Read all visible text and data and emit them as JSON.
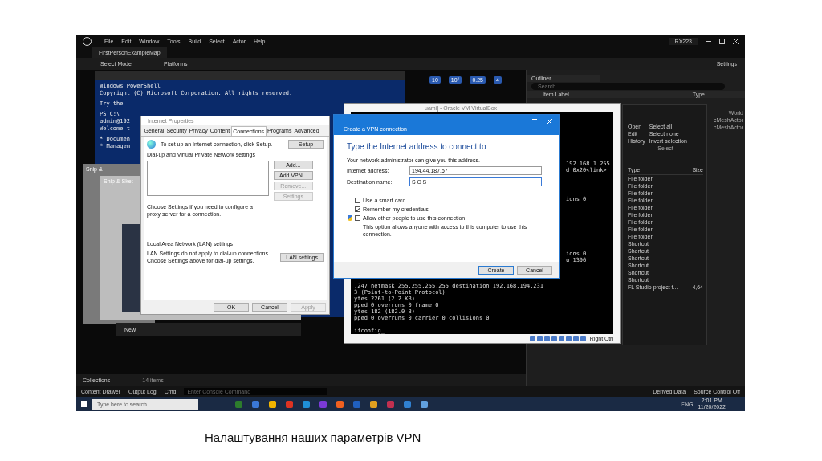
{
  "editor": {
    "menu": [
      "File",
      "Edit",
      "Window",
      "Tools",
      "Build",
      "Select",
      "Actor",
      "Help"
    ],
    "title_badge": "RX223",
    "map_tab": "FirstPersonExampleMap",
    "select_mode": "Select Mode",
    "platforms": "Platforms",
    "settings": "Settings",
    "viewport_toolbar": [
      "10",
      "10°",
      "0.25",
      "4"
    ]
  },
  "outliner": {
    "title": "Outliner",
    "search_placeholder": "Search",
    "column_1": "Item Label",
    "column_2": "Type",
    "rows": [
      "World",
      "cMeshActor",
      "cMeshActor"
    ]
  },
  "explorer": {
    "actions": [
      "Open",
      "Edit",
      "History"
    ],
    "select_actions": [
      "Select all",
      "Select none",
      "Invert selection"
    ],
    "group_label": "Select",
    "columns": [
      "Type",
      "Size"
    ],
    "rows": [
      {
        "type": "File folder"
      },
      {
        "type": "File folder"
      },
      {
        "type": "File folder"
      },
      {
        "type": "File folder"
      },
      {
        "type": "File folder"
      },
      {
        "type": "File folder"
      },
      {
        "type": "File folder"
      },
      {
        "type": "File folder"
      },
      {
        "type": "File folder"
      },
      {
        "type": "Shortcut"
      },
      {
        "type": "Shortcut"
      },
      {
        "type": "Shortcut"
      },
      {
        "type": "Shortcut"
      },
      {
        "type": "Shortcut"
      },
      {
        "type": "Shortcut"
      },
      {
        "type": "FL Studio project f...",
        "size": "4,64"
      }
    ]
  },
  "powershell": {
    "lines": [
      "Windows PowerShell",
      "Copyright (C) Microsoft Corporation. All rights reserved.",
      "Try the",
      "PS C:\\",
      "admin@192",
      "Welcome t",
      "* Documen",
      "* Managem"
    ]
  },
  "snip_windows": [
    "Snip &",
    "Snip & Sket"
  ],
  "snip_toolbar": {
    "new": "New"
  },
  "internet_properties": {
    "title": "Internet Properties",
    "tabs": [
      {
        "label": "General",
        "selected": false
      },
      {
        "label": "Security",
        "selected": false
      },
      {
        "label": "Privacy",
        "selected": false
      },
      {
        "label": "Content",
        "selected": false
      },
      {
        "label": "Connections",
        "selected": true
      },
      {
        "label": "Programs",
        "selected": false
      },
      {
        "label": "Advanced",
        "selected": false
      }
    ],
    "setup_text": "To set up an Internet connection, click Setup.",
    "setup_button": "Setup",
    "dialup_heading": "Dial-up and Virtual Private Network settings",
    "side_buttons": [
      {
        "label": "Add...",
        "disabled": false
      },
      {
        "label": "Add VPN...",
        "disabled": false
      },
      {
        "label": "Remove...",
        "disabled": true
      },
      {
        "label": "Settings",
        "disabled": true
      }
    ],
    "proxy_text": "Choose Settings if you need to configure a proxy server for a connection.",
    "lan_heading": "Local Area Network (LAN) settings",
    "lan_text": "LAN Settings do not apply to dial-up connections. Choose Settings above for dial-up settings.",
    "lan_button": "LAN settings",
    "buttons": [
      {
        "label": "OK",
        "disabled": false
      },
      {
        "label": "Cancel",
        "disabled": false
      },
      {
        "label": "Apply",
        "disabled": true
      }
    ]
  },
  "virtualbox": {
    "title": "uami] - Oracle VM VirtualBox",
    "host_key": "Right Ctrl",
    "lines": [
      {
        "kind": "right",
        "text": "192.168.1.255"
      },
      {
        "kind": "right",
        "text": "d 0x20<link>"
      },
      {
        "kind": "right",
        "text": "ions 0"
      },
      {
        "kind": "right",
        "text": "ions 0"
      },
      {
        "kind": "right",
        "text": "u 1396"
      },
      {
        "kind": "full",
        "text": ".247  netmask 255.255.255.255  destination 192.168.194.231"
      },
      {
        "kind": "full",
        "text": "3  (Point-to-Point Protocol)"
      },
      {
        "kind": "full",
        "text": "ytes 2261 (2.2 KB)"
      },
      {
        "kind": "full",
        "text": "pped 0  overruns 0  frame 0"
      },
      {
        "kind": "full",
        "text": "ytes 182 (182.0 B)"
      },
      {
        "kind": "full",
        "text": "pped 0 overruns 0  carrier 0  collisions 0"
      },
      {
        "kind": "full",
        "text": "ifconfig_"
      }
    ]
  },
  "vpn_dialog": {
    "title": "Create a VPN connection",
    "heading": "Type the Internet address to connect to",
    "intro": "Your network administrator can give you this address.",
    "fields": [
      {
        "label": "Internet address:",
        "value": "194.44.187.57"
      },
      {
        "label": "Destination name:",
        "value": "S C S"
      }
    ],
    "options": [
      {
        "label": "Use a smart card",
        "checked": false
      },
      {
        "label": "Remember my credentials",
        "checked": true
      },
      {
        "label": "Allow other people to use this connection",
        "checked": false,
        "note": "This option allows anyone with access to this computer to use this connection."
      }
    ],
    "buttons": [
      "Create",
      "Cancel"
    ]
  },
  "content_browser": {
    "collections": "Collections",
    "count": "14 items"
  },
  "status_bar": {
    "left": [
      "Content Drawer",
      "Output Log"
    ],
    "cmd": "Cmd",
    "console_placeholder": "Enter Console Command",
    "right": [
      "Derived Data",
      "Source Control Off"
    ]
  },
  "taskbar": {
    "search_placeholder": "Type here to search",
    "language": "ENG",
    "time": "2:01 PM",
    "date": "11/20/2022"
  },
  "caption": "Налаштування наших параметрів VPN"
}
